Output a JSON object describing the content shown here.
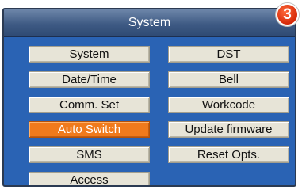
{
  "window": {
    "title": "System"
  },
  "step_badge": "3",
  "menu": {
    "left": [
      {
        "label": "System"
      },
      {
        "label": "Date/Time"
      },
      {
        "label": "Comm. Set"
      },
      {
        "label": "Auto Switch",
        "selected": true
      },
      {
        "label": "SMS"
      },
      {
        "label": "Access"
      }
    ],
    "right": [
      {
        "label": "DST"
      },
      {
        "label": "Bell"
      },
      {
        "label": "Workcode"
      },
      {
        "label": "Update firmware"
      },
      {
        "label": "Reset Opts."
      }
    ]
  },
  "colors": {
    "background": "#2a63b4",
    "button": "#e7e4d7",
    "selected": "#f07a1c",
    "badge": "#e0350f"
  }
}
